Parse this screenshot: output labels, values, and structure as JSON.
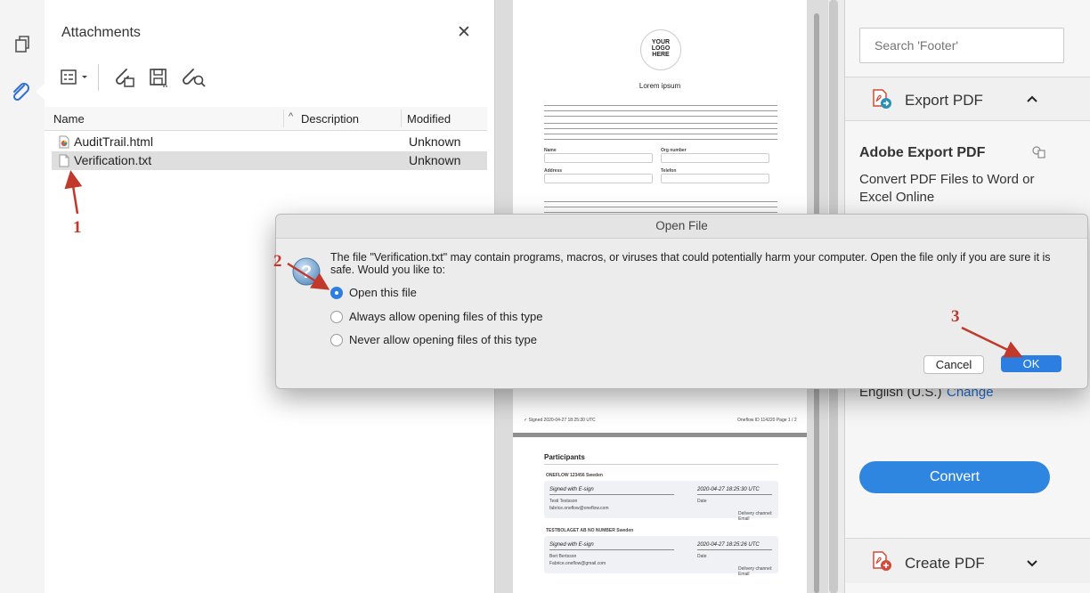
{
  "rail": {
    "icons": [
      "pages-icon",
      "attachment-icon"
    ]
  },
  "attachments": {
    "title": "Attachments",
    "close_glyph": "✕",
    "toolbar_icons": [
      "options-menu-icon",
      "open-attachment-icon",
      "save-attachment-icon",
      "search-attachment-icon"
    ],
    "columns": {
      "name": "Name",
      "description": "Description",
      "modified": "Modified"
    },
    "rows": [
      {
        "name": "AuditTrail.html",
        "description": "",
        "modified": "Unknown",
        "selected": false
      },
      {
        "name": "Verification.txt",
        "description": "",
        "modified": "Unknown",
        "selected": true
      }
    ]
  },
  "document": {
    "logo": [
      "YOUR",
      "LOGO",
      "HERE"
    ],
    "heading": "Lorem ipsum",
    "labels": {
      "name": "Name",
      "org_number": "Org number",
      "address": "Address",
      "telefon": "Telefon"
    },
    "footer_signed": "✓ Signed 2020-04-27 18:25:30 UTC",
    "footer_id": "Oneflow ID 114220   Page 1 / 2",
    "participants_title": "Participants",
    "party1": "ONEFLOW  123456  Sweden",
    "party1_sign": "Signed with E-sign",
    "party1_date": "2020-04-27 18:25:30 UTC",
    "party1_person": "Testi Testsson",
    "party1_email": "fabrice.oneflow@oneflow.com",
    "party2": "TESTBOLAGET AB  NO NUMBER  Sweden",
    "party2_sign": "Signed with E-sign",
    "party2_date": "2020-04-27 18:25:26 UTC",
    "party2_person": "Bert Bertsson",
    "party2_email": "Fabrice.oneflow@gmail.com",
    "date_label": "Date",
    "delivery": "Delivery channel: Email"
  },
  "right_pane": {
    "search_placeholder": "Search 'Footer'",
    "export_label": "Export PDF",
    "adobe_export_title": "Adobe Export PDF",
    "export_description": "Convert PDF Files to Word or Excel Online",
    "language": "English (U.S.)",
    "change_link": "Change",
    "convert_label": "Convert",
    "create_label": "Create PDF"
  },
  "dialog": {
    "title": "Open File",
    "message": "The file \"Verification.txt\" may contain programs, macros, or viruses that could potentially harm your computer. Open the file only if you are sure it is safe. Would you like to:",
    "options": [
      {
        "label": "Open this file",
        "selected": true
      },
      {
        "label": "Always allow opening files of this type",
        "selected": false
      },
      {
        "label": "Never allow opening files of this type",
        "selected": false
      }
    ],
    "cancel_label": "Cancel",
    "ok_label": "OK"
  },
  "annotations": {
    "step1": "1",
    "step2": "2",
    "step3": "3",
    "color": "#c0392b"
  }
}
